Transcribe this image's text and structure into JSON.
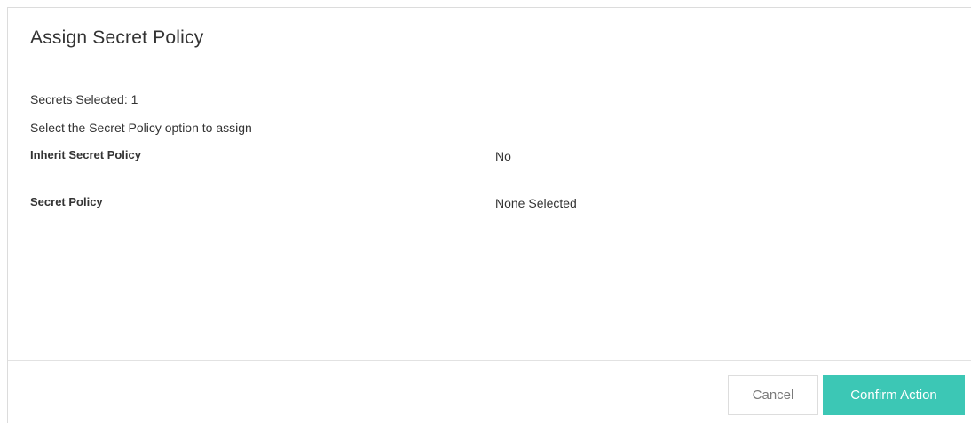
{
  "dialog": {
    "title": "Assign Secret Policy",
    "secrets_selected": "Secrets Selected: 1",
    "instruction": "Select the Secret Policy option to assign"
  },
  "fields": {
    "inherit": {
      "label": "Inherit Secret Policy",
      "value": "No"
    },
    "policy": {
      "label": "Secret Policy",
      "value": "None Selected"
    }
  },
  "buttons": {
    "cancel": "Cancel",
    "confirm": "Confirm Action"
  },
  "colors": {
    "accent": "#3cc7b5",
    "text": "#333333",
    "border": "#dcdcdc"
  }
}
